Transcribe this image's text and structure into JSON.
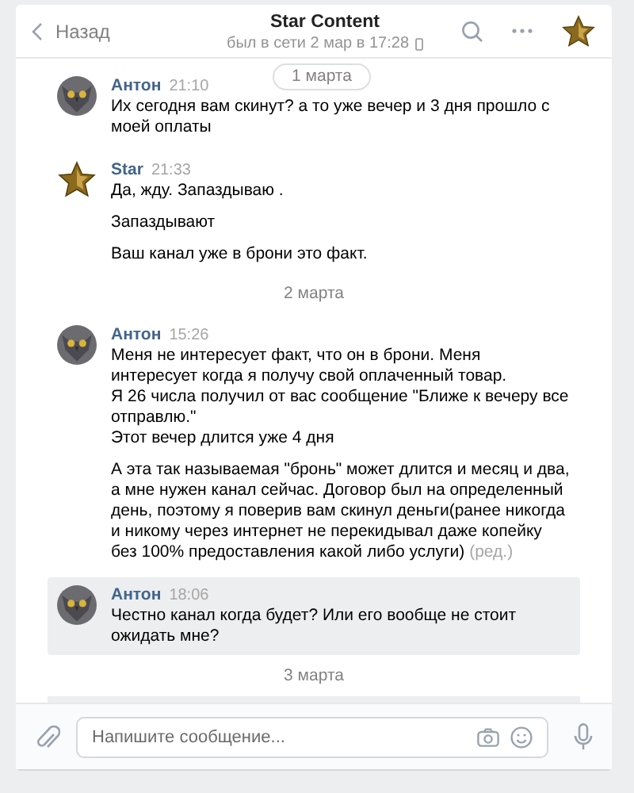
{
  "header": {
    "back": "Назад",
    "title": "Star Content",
    "status": "был в сети 2 мар в 17:28"
  },
  "floating_date": "1 марта",
  "feed": [
    {
      "kind": "message",
      "outgoing": true,
      "author": "Антон",
      "time": "21:10",
      "highlighted": false,
      "paragraphs": [
        [
          "Их сегодня вам скинут? а то уже вечер и 3 дня прошло с моей оплаты"
        ]
      ]
    },
    {
      "kind": "message",
      "outgoing": false,
      "author": "Star",
      "time": "21:33",
      "highlighted": false,
      "paragraphs": [
        [
          "Да, жду. Запаздываю ."
        ],
        [
          "Запаздывают"
        ],
        [
          "Ваш канал уже в брони это факт."
        ]
      ]
    },
    {
      "kind": "date",
      "text": "2 марта"
    },
    {
      "kind": "message",
      "outgoing": true,
      "author": "Антон",
      "time": "15:26",
      "highlighted": false,
      "paragraphs": [
        [
          "Меня не интересует факт, что он в брони. Меня интересует когда я получу свой оплаченный товар.",
          "Я 26 числа получил от вас сообщение \"Ближе к вечеру все отправлю.\"",
          "Этот вечер длится уже 4 дня"
        ],
        [
          "А эта так называемая \"бронь\" может длится и месяц и два, а мне нужен канал сейчас. Договор был на определенный день, поэтому я поверив вам скинул деньги(ранее никогда и никому через интернет не перекидывал даже копейку без 100% предоставления какой либо услуги)"
        ]
      ],
      "edited": "(ред.)"
    },
    {
      "kind": "message",
      "outgoing": true,
      "author": "Антон",
      "time": "18:06",
      "highlighted": true,
      "paragraphs": [
        [
          "Честно канал когда будет? Или его вообще не стоит ожидать мне?"
        ]
      ]
    },
    {
      "kind": "date",
      "text": "3 марта"
    }
  ],
  "composer": {
    "placeholder": "Напишите сообщение..."
  }
}
